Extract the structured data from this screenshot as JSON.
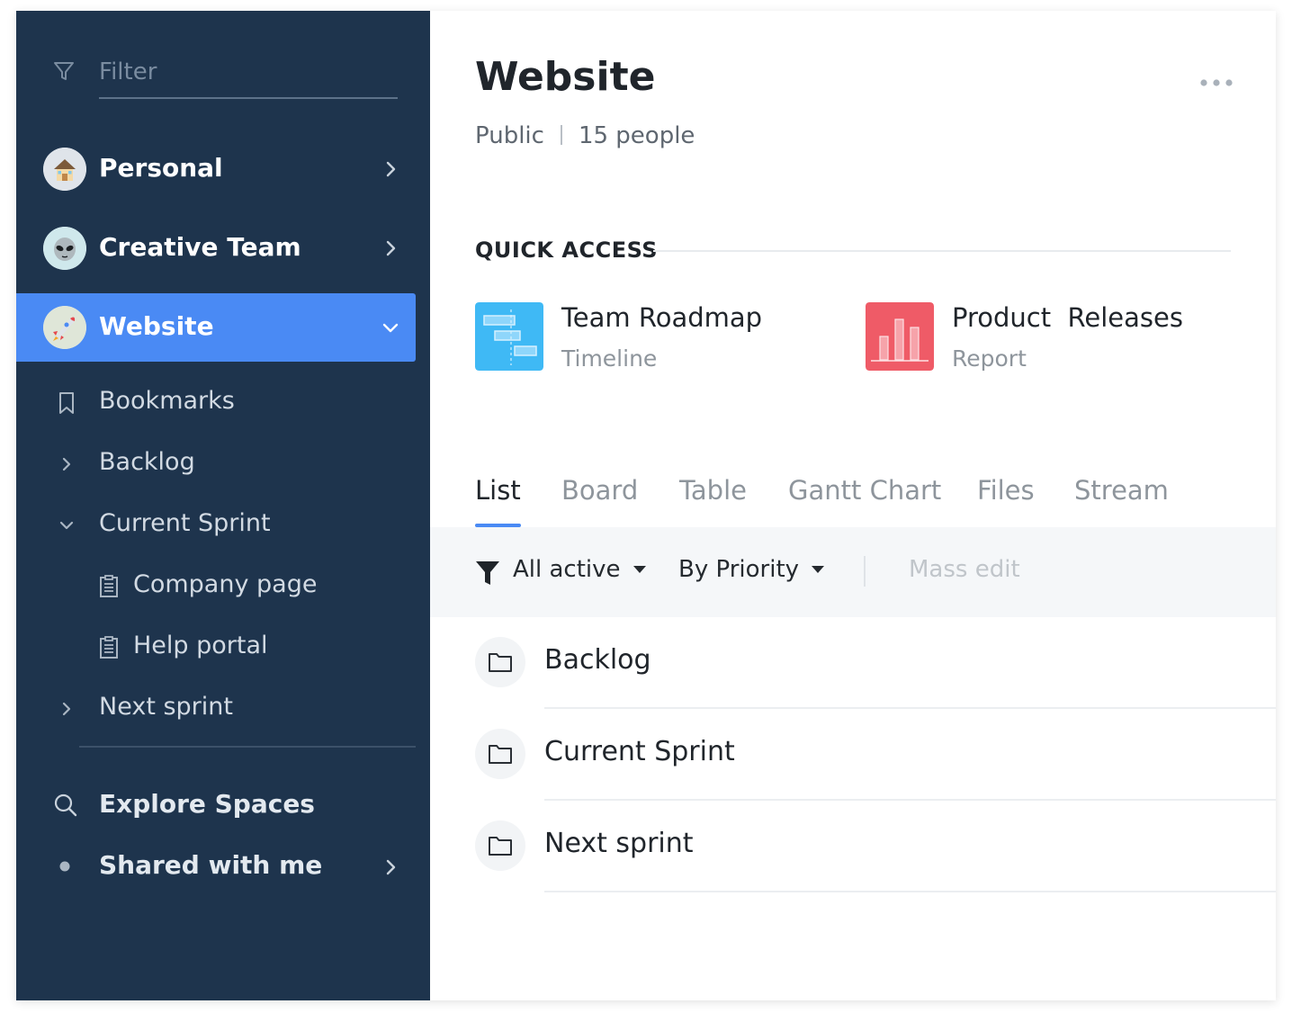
{
  "sidebar": {
    "filter": {
      "placeholder": "Filter"
    },
    "spaces": [
      {
        "label": "Personal",
        "avatar": "house-emoji-icon"
      },
      {
        "label": "Creative Team",
        "avatar": "alien-emoji-icon"
      },
      {
        "label": "Website",
        "avatar": "rocket-emoji-icon",
        "active": true
      }
    ],
    "tree": [
      {
        "label": "Bookmarks",
        "icon": "bookmark-icon"
      },
      {
        "label": "Backlog",
        "icon": "chevron-right-icon"
      },
      {
        "label": "Current Sprint",
        "icon": "chevron-down-icon"
      },
      {
        "label": "Company page",
        "icon": "document-icon"
      },
      {
        "label": "Help portal",
        "icon": "document-icon"
      },
      {
        "label": "Next sprint",
        "icon": "chevron-right-icon"
      }
    ],
    "explore": {
      "label": "Explore Spaces"
    },
    "shared": {
      "label": "Shared with me"
    }
  },
  "main": {
    "title": "Website",
    "visibility": "Public",
    "people": "15 people",
    "quick_access": {
      "title": "QUICK ACCESS",
      "items": [
        {
          "name": "Team Roadmap",
          "type": "Timeline",
          "color": "#3fb9f5"
        },
        {
          "name": "Product  Releases",
          "type": "Report",
          "color": "#ef5b67"
        }
      ]
    },
    "tabs": [
      "List",
      "Board",
      "Table",
      "Gantt Chart",
      "Files",
      "Stream"
    ],
    "toolbar": {
      "filter_label": "All active",
      "sort_label": "By Priority",
      "mass_edit": "Mass edit"
    },
    "folders": [
      "Backlog",
      "Current Sprint",
      "Next sprint"
    ]
  },
  "colors": {
    "sidebar_bg": "#1e344d",
    "accent": "#4a8af4",
    "toolbar_bg": "#f5f7f9"
  }
}
